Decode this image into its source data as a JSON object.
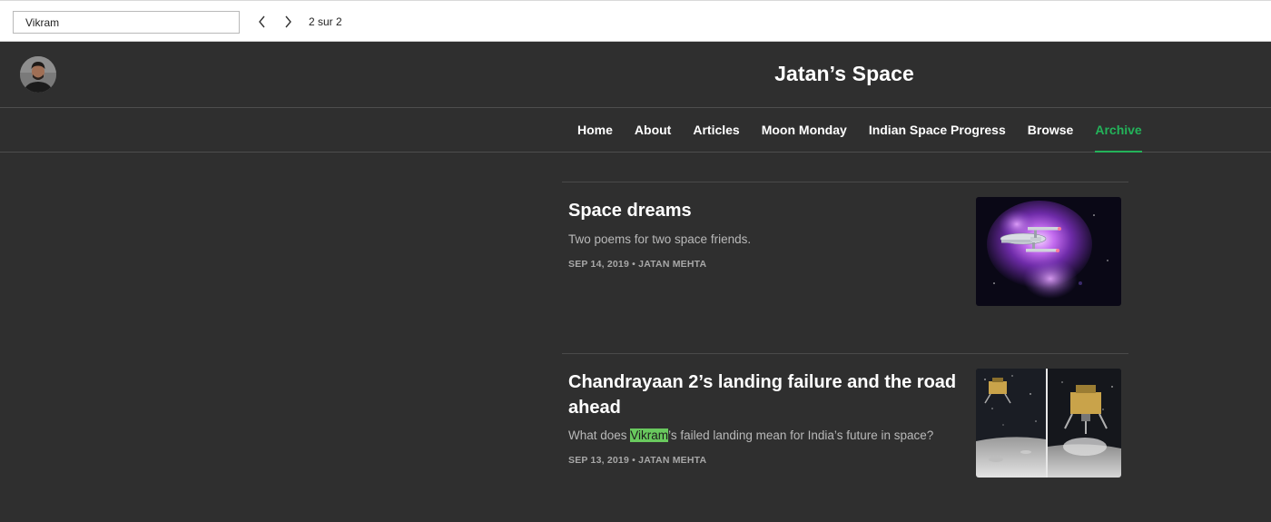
{
  "find_bar": {
    "query": "Vikram",
    "match_count": "2 sur 2",
    "prev_icon": "chevron-left-icon",
    "next_icon": "chevron-right-icon"
  },
  "site": {
    "title": "Jatan’s Space"
  },
  "nav": {
    "items": [
      {
        "label": "Home"
      },
      {
        "label": "About"
      },
      {
        "label": "Articles"
      },
      {
        "label": "Moon Monday"
      },
      {
        "label": "Indian Space Progress"
      },
      {
        "label": "Browse"
      },
      {
        "label": "Archive"
      }
    ],
    "active": "Archive"
  },
  "posts": [
    {
      "title": "Space dreams",
      "excerpt": "Two poems for two space friends.",
      "date": "SEP 14, 2019",
      "author": "JATAN MEHTA"
    },
    {
      "title": "Chandrayaan 2’s landing failure and the road ahead",
      "excerpt_before": "What does ",
      "excerpt_highlight": "Vikram",
      "excerpt_after": "’s failed landing mean for India’s future in space?",
      "date": "SEP 13, 2019",
      "author": "JATAN MEHTA"
    }
  ],
  "meta_separator": "•",
  "colors": {
    "page_background": "#2f2f2f",
    "accent": "#23b35a",
    "find_highlight": "#69c95e"
  }
}
